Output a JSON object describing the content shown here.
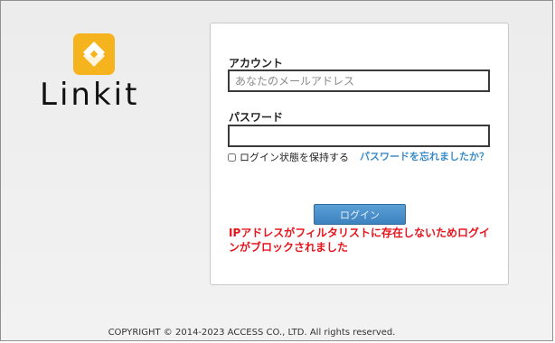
{
  "brand": {
    "name": "Linkit",
    "logo_icon": "linkit-logo-icon",
    "logo_color": "#f5b31e"
  },
  "form": {
    "account_label": "アカウント",
    "account_placeholder": "あなたのメールアドレス",
    "account_value": "",
    "password_label": "パスワード",
    "password_value": "",
    "remember_label": "ログイン状態を保持する",
    "remember_checked": false,
    "forgot_link": "パスワードを忘れましたか？",
    "login_button": "ログイン",
    "error_message": "IPアドレスがフィルタリストに存在しないためログインがブロックされました"
  },
  "footer": {
    "copyright": "COPYRIGHT © 2014-2023 ACCESS CO., LTD. All rights reserved."
  },
  "colors": {
    "link": "#3c8cc8",
    "error": "#e8141c",
    "button": "#4a90cc"
  }
}
